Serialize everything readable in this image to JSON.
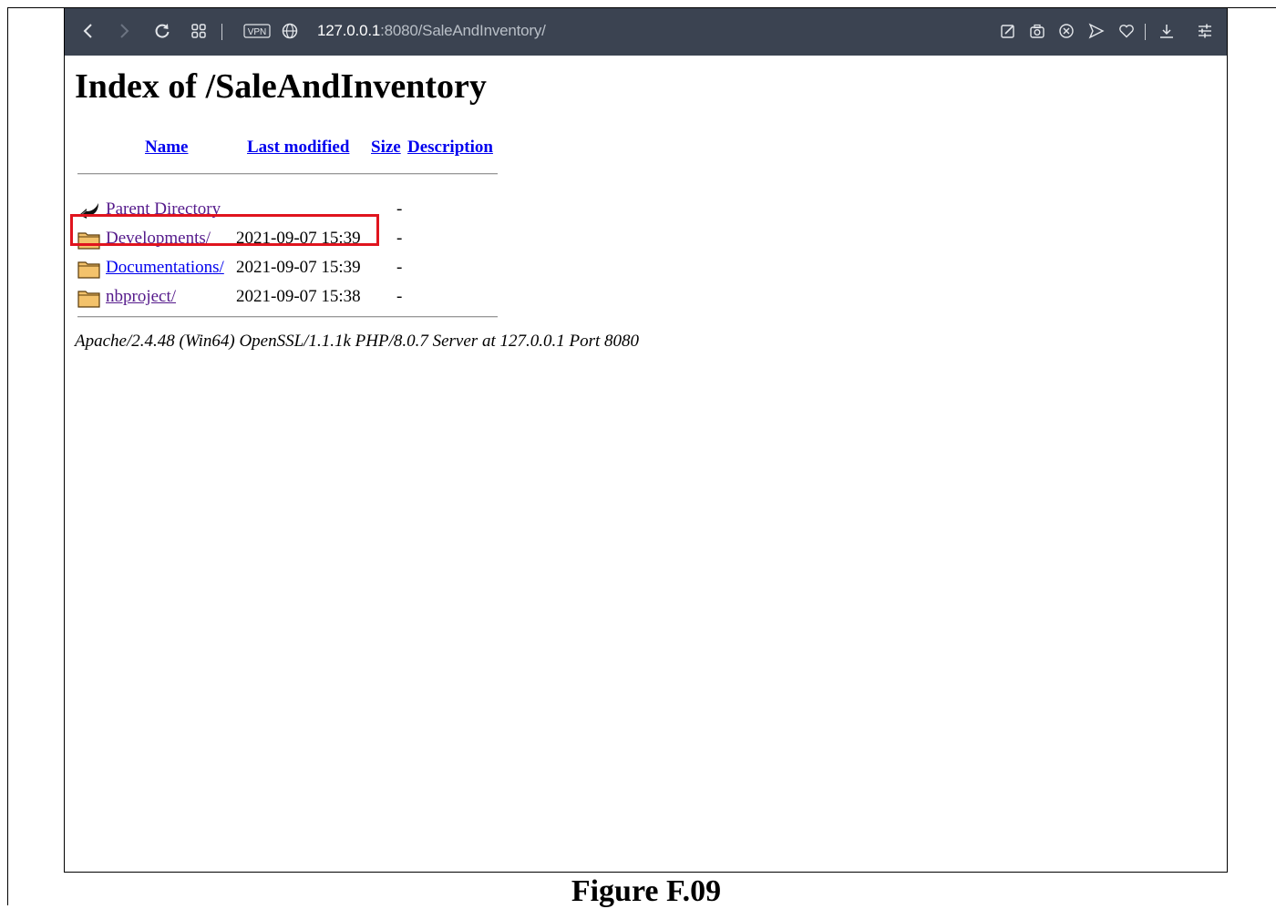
{
  "browser": {
    "url_host": "127.0.0.1",
    "url_rest": ":8080/SaleAndInventory/",
    "vpn_label": "VPN",
    "icons": [
      "back-icon",
      "forward-icon",
      "reload-icon",
      "tabs-grid-icon",
      "vpn-badge",
      "globe-icon",
      "edit-icon",
      "camera-icon",
      "close-circle-icon",
      "send-icon",
      "heart-icon",
      "download-icon",
      "settings-sliders-icon"
    ]
  },
  "page": {
    "title": "Index of /SaleAndInventory",
    "columns": {
      "name": "Name",
      "last_modified": "Last modified",
      "size": "Size",
      "description": "Description"
    },
    "rows": [
      {
        "name": "Parent Directory",
        "date": "",
        "size": "-",
        "icon": "back-arrow-icon"
      },
      {
        "name": "Developments/",
        "date": "2021-09-07 15:39",
        "size": "-",
        "icon": "folder-icon"
      },
      {
        "name": "Documentations/",
        "date": "2021-09-07 15:39",
        "size": "-",
        "icon": "folder-icon"
      },
      {
        "name": "nbproject/",
        "date": "2021-09-07 15:38",
        "size": "-",
        "icon": "folder-icon"
      }
    ],
    "server_signature": "Apache/2.4.48 (Win64) OpenSSL/1.1.1k PHP/8.0.7 Server at 127.0.0.1 Port 8080"
  },
  "caption": "Figure F.09",
  "colors": {
    "toolbar_bg": "#3b4351",
    "link": "#0000ee",
    "visited_link": "#551a8b",
    "highlight_box": "#e0141e"
  }
}
